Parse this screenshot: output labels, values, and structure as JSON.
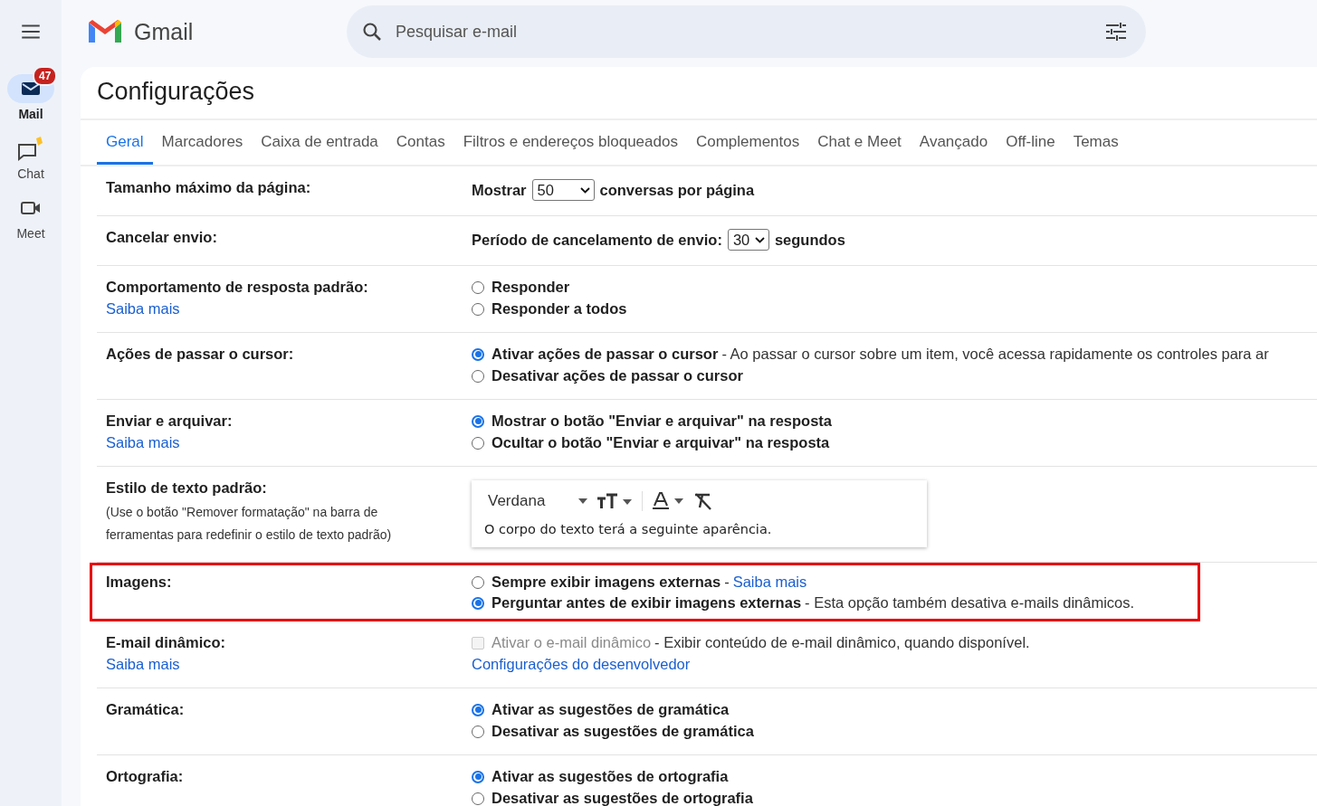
{
  "sidebar": {
    "items": [
      {
        "label": "Mail",
        "selected": true,
        "badge": "47"
      },
      {
        "label": "Chat",
        "selected": false
      },
      {
        "label": "Meet",
        "selected": false
      }
    ]
  },
  "header": {
    "logo_text": "Gmail",
    "search": {
      "placeholder": "Pesquisar e-mail"
    }
  },
  "page_title": "Configurações",
  "tabs": [
    {
      "label": "Geral",
      "selected": true
    },
    {
      "label": "Marcadores",
      "selected": false
    },
    {
      "label": "Caixa de entrada",
      "selected": false
    },
    {
      "label": "Contas",
      "selected": false
    },
    {
      "label": "Filtros e endereços bloqueados",
      "selected": false
    },
    {
      "label": "Complementos",
      "selected": false
    },
    {
      "label": "Chat e Meet",
      "selected": false
    },
    {
      "label": "Avançado",
      "selected": false
    },
    {
      "label": "Off-line",
      "selected": false
    },
    {
      "label": "Temas",
      "selected": false
    }
  ],
  "settings": [
    {
      "kind": "select",
      "label": "Tamanho máximo da página:",
      "highlighted": false,
      "prefix": "Mostrar",
      "value": "50",
      "suffix": "conversas por página",
      "wide": true
    },
    {
      "kind": "select",
      "label": "Cancelar envio:",
      "highlighted": false,
      "prefix": "Período de cancelamento de envio:",
      "value": "30",
      "suffix": "segundos",
      "wide": false
    },
    {
      "kind": "radio",
      "label": "Comportamento de resposta padrão:",
      "link": "Saiba mais",
      "highlighted": false,
      "options": [
        {
          "label": "Responder",
          "selected": false
        },
        {
          "label": "Responder a todos",
          "selected": false
        }
      ]
    },
    {
      "kind": "radio",
      "label": "Ações de passar o cursor:",
      "highlighted": false,
      "options": [
        {
          "label": "Ativar ações de passar o cursor",
          "description": "- Ao passar o cursor sobre um item, você acessa rapidamente os controles para ar",
          "selected": true
        },
        {
          "label": "Desativar ações de passar o cursor",
          "selected": false
        }
      ]
    },
    {
      "kind": "radio",
      "label": "Enviar e arquivar:",
      "link": "Saiba mais",
      "highlighted": false,
      "options": [
        {
          "label": "Mostrar o botão \"Enviar e arquivar\" na resposta",
          "selected": true
        },
        {
          "label": "Ocultar o botão \"Enviar e arquivar\" na resposta",
          "selected": false
        }
      ]
    },
    {
      "kind": "text_style",
      "label": "Estilo de texto padrão:",
      "highlighted": false,
      "note": "(Use o botão \"Remover formatação\" na barra de ferramentas para redefinir o estilo de texto padrão)",
      "font": "Verdana",
      "preview": "O corpo do texto terá a seguinte aparência."
    },
    {
      "kind": "radio",
      "label": "Imagens:",
      "highlighted": true,
      "options": [
        {
          "label": "Sempre exibir imagens externas",
          "description": "-",
          "link": "Saiba mais",
          "selected": false
        },
        {
          "label": "Perguntar antes de exibir imagens externas",
          "description": "- Esta opção também desativa e-mails dinâmicos.",
          "selected": true
        }
      ]
    },
    {
      "kind": "checkbox",
      "label": "E-mail dinâmico:",
      "link": "Saiba mais",
      "highlighted": false,
      "option": {
        "label": "Ativar o e-mail dinâmico",
        "description": "- Exibir conteúdo de e-mail dinâmico, quando disponível.",
        "checked": false,
        "disabled": true
      },
      "extra_link": "Configurações do desenvolvedor"
    },
    {
      "kind": "radio",
      "label": "Gramática:",
      "highlighted": false,
      "options": [
        {
          "label": "Ativar as sugestões de gramática",
          "selected": true
        },
        {
          "label": "Desativar as sugestões de gramática",
          "selected": false
        }
      ]
    },
    {
      "kind": "radio",
      "label": "Ortografia:",
      "highlighted": false,
      "options": [
        {
          "label": "Ativar as sugestões de ortografia",
          "selected": true
        },
        {
          "label": "Desativar as sugestões de ortografia",
          "selected": false
        }
      ]
    }
  ]
}
